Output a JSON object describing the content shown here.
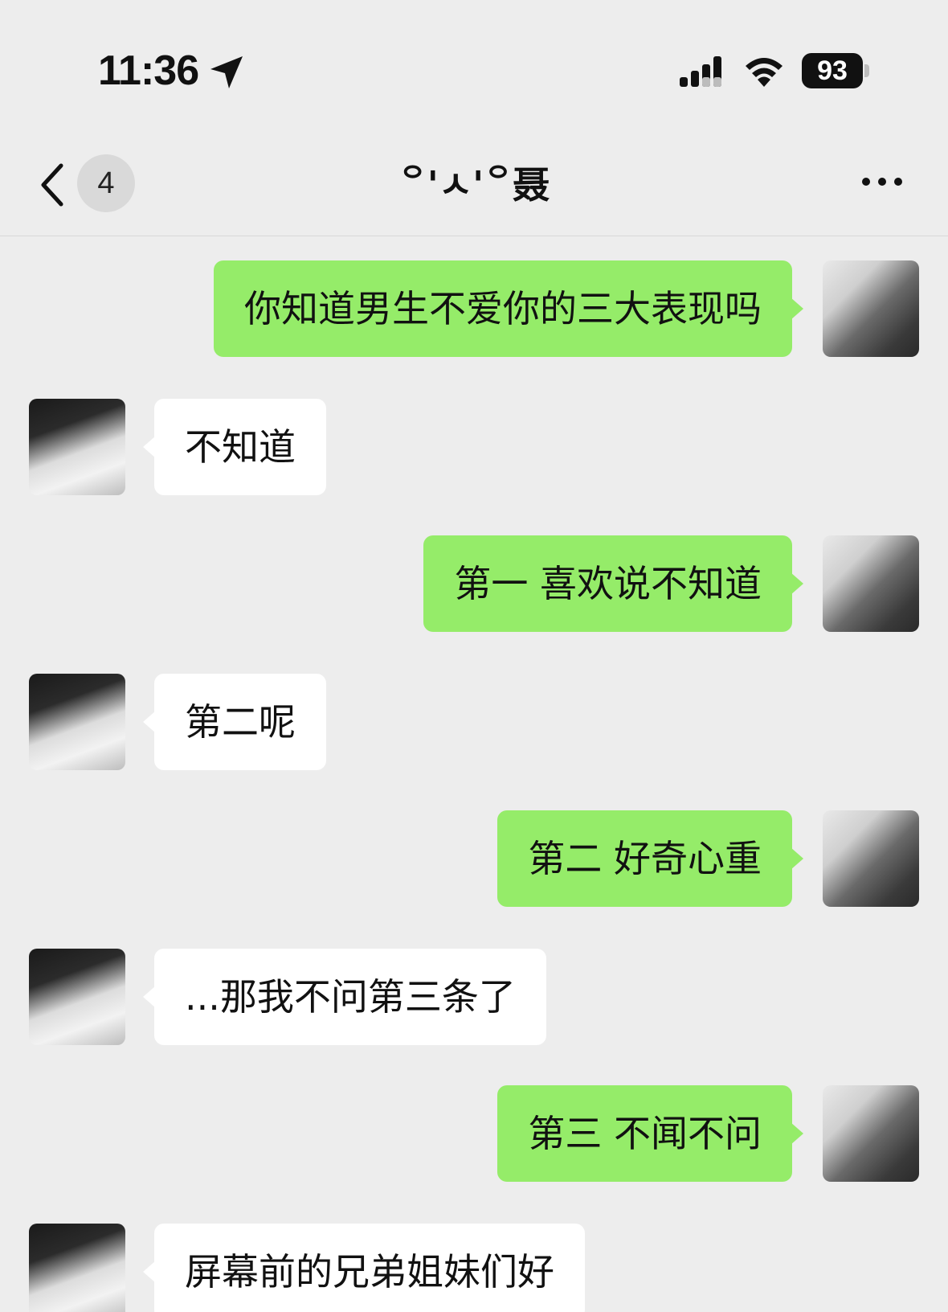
{
  "status_bar": {
    "time": "11:36",
    "battery": "93",
    "icons": [
      "location-arrow-icon",
      "cellular-signal-icon",
      "wifi-icon",
      "battery-icon"
    ]
  },
  "nav": {
    "unread_count": "4",
    "title": "꒪'ㅅ'꒪聂",
    "icons": [
      "back-chevron-icon",
      "more-icon"
    ]
  },
  "messages": [
    {
      "from": "self",
      "text": "你知道男生不爱你的三大表现吗"
    },
    {
      "from": "other",
      "text": "不知道"
    },
    {
      "from": "self",
      "text": "第一 喜欢说不知道"
    },
    {
      "from": "other",
      "text": "第二呢"
    },
    {
      "from": "self",
      "text": "第二 好奇心重"
    },
    {
      "from": "other",
      "text": "...那我不问第三条了"
    },
    {
      "from": "self",
      "text": "第三 不闻不问"
    },
    {
      "from": "other",
      "text": "屏幕前的兄弟姐妹们好"
    }
  ],
  "colors": {
    "background": "#ededed",
    "self_bubble": "#95ec69",
    "other_bubble": "#ffffff"
  }
}
